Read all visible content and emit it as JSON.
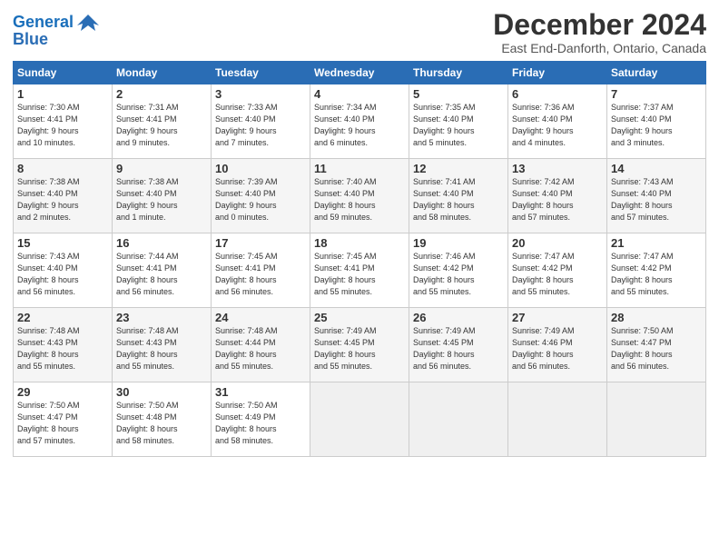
{
  "header": {
    "logo_line1": "General",
    "logo_line2": "Blue",
    "title": "December 2024",
    "location": "East End-Danforth, Ontario, Canada"
  },
  "days_of_week": [
    "Sunday",
    "Monday",
    "Tuesday",
    "Wednesday",
    "Thursday",
    "Friday",
    "Saturday"
  ],
  "weeks": [
    [
      {
        "day": 1,
        "info": "Sunrise: 7:30 AM\nSunset: 4:41 PM\nDaylight: 9 hours\nand 10 minutes."
      },
      {
        "day": 2,
        "info": "Sunrise: 7:31 AM\nSunset: 4:41 PM\nDaylight: 9 hours\nand 9 minutes."
      },
      {
        "day": 3,
        "info": "Sunrise: 7:33 AM\nSunset: 4:40 PM\nDaylight: 9 hours\nand 7 minutes."
      },
      {
        "day": 4,
        "info": "Sunrise: 7:34 AM\nSunset: 4:40 PM\nDaylight: 9 hours\nand 6 minutes."
      },
      {
        "day": 5,
        "info": "Sunrise: 7:35 AM\nSunset: 4:40 PM\nDaylight: 9 hours\nand 5 minutes."
      },
      {
        "day": 6,
        "info": "Sunrise: 7:36 AM\nSunset: 4:40 PM\nDaylight: 9 hours\nand 4 minutes."
      },
      {
        "day": 7,
        "info": "Sunrise: 7:37 AM\nSunset: 4:40 PM\nDaylight: 9 hours\nand 3 minutes."
      }
    ],
    [
      {
        "day": 8,
        "info": "Sunrise: 7:38 AM\nSunset: 4:40 PM\nDaylight: 9 hours\nand 2 minutes."
      },
      {
        "day": 9,
        "info": "Sunrise: 7:38 AM\nSunset: 4:40 PM\nDaylight: 9 hours\nand 1 minute."
      },
      {
        "day": 10,
        "info": "Sunrise: 7:39 AM\nSunset: 4:40 PM\nDaylight: 9 hours\nand 0 minutes."
      },
      {
        "day": 11,
        "info": "Sunrise: 7:40 AM\nSunset: 4:40 PM\nDaylight: 8 hours\nand 59 minutes."
      },
      {
        "day": 12,
        "info": "Sunrise: 7:41 AM\nSunset: 4:40 PM\nDaylight: 8 hours\nand 58 minutes."
      },
      {
        "day": 13,
        "info": "Sunrise: 7:42 AM\nSunset: 4:40 PM\nDaylight: 8 hours\nand 57 minutes."
      },
      {
        "day": 14,
        "info": "Sunrise: 7:43 AM\nSunset: 4:40 PM\nDaylight: 8 hours\nand 57 minutes."
      }
    ],
    [
      {
        "day": 15,
        "info": "Sunrise: 7:43 AM\nSunset: 4:40 PM\nDaylight: 8 hours\nand 56 minutes."
      },
      {
        "day": 16,
        "info": "Sunrise: 7:44 AM\nSunset: 4:41 PM\nDaylight: 8 hours\nand 56 minutes."
      },
      {
        "day": 17,
        "info": "Sunrise: 7:45 AM\nSunset: 4:41 PM\nDaylight: 8 hours\nand 56 minutes."
      },
      {
        "day": 18,
        "info": "Sunrise: 7:45 AM\nSunset: 4:41 PM\nDaylight: 8 hours\nand 55 minutes."
      },
      {
        "day": 19,
        "info": "Sunrise: 7:46 AM\nSunset: 4:42 PM\nDaylight: 8 hours\nand 55 minutes."
      },
      {
        "day": 20,
        "info": "Sunrise: 7:47 AM\nSunset: 4:42 PM\nDaylight: 8 hours\nand 55 minutes."
      },
      {
        "day": 21,
        "info": "Sunrise: 7:47 AM\nSunset: 4:42 PM\nDaylight: 8 hours\nand 55 minutes."
      }
    ],
    [
      {
        "day": 22,
        "info": "Sunrise: 7:48 AM\nSunset: 4:43 PM\nDaylight: 8 hours\nand 55 minutes."
      },
      {
        "day": 23,
        "info": "Sunrise: 7:48 AM\nSunset: 4:43 PM\nDaylight: 8 hours\nand 55 minutes."
      },
      {
        "day": 24,
        "info": "Sunrise: 7:48 AM\nSunset: 4:44 PM\nDaylight: 8 hours\nand 55 minutes."
      },
      {
        "day": 25,
        "info": "Sunrise: 7:49 AM\nSunset: 4:45 PM\nDaylight: 8 hours\nand 55 minutes."
      },
      {
        "day": 26,
        "info": "Sunrise: 7:49 AM\nSunset: 4:45 PM\nDaylight: 8 hours\nand 56 minutes."
      },
      {
        "day": 27,
        "info": "Sunrise: 7:49 AM\nSunset: 4:46 PM\nDaylight: 8 hours\nand 56 minutes."
      },
      {
        "day": 28,
        "info": "Sunrise: 7:50 AM\nSunset: 4:47 PM\nDaylight: 8 hours\nand 56 minutes."
      }
    ],
    [
      {
        "day": 29,
        "info": "Sunrise: 7:50 AM\nSunset: 4:47 PM\nDaylight: 8 hours\nand 57 minutes."
      },
      {
        "day": 30,
        "info": "Sunrise: 7:50 AM\nSunset: 4:48 PM\nDaylight: 8 hours\nand 58 minutes."
      },
      {
        "day": 31,
        "info": "Sunrise: 7:50 AM\nSunset: 4:49 PM\nDaylight: 8 hours\nand 58 minutes."
      },
      null,
      null,
      null,
      null
    ]
  ]
}
